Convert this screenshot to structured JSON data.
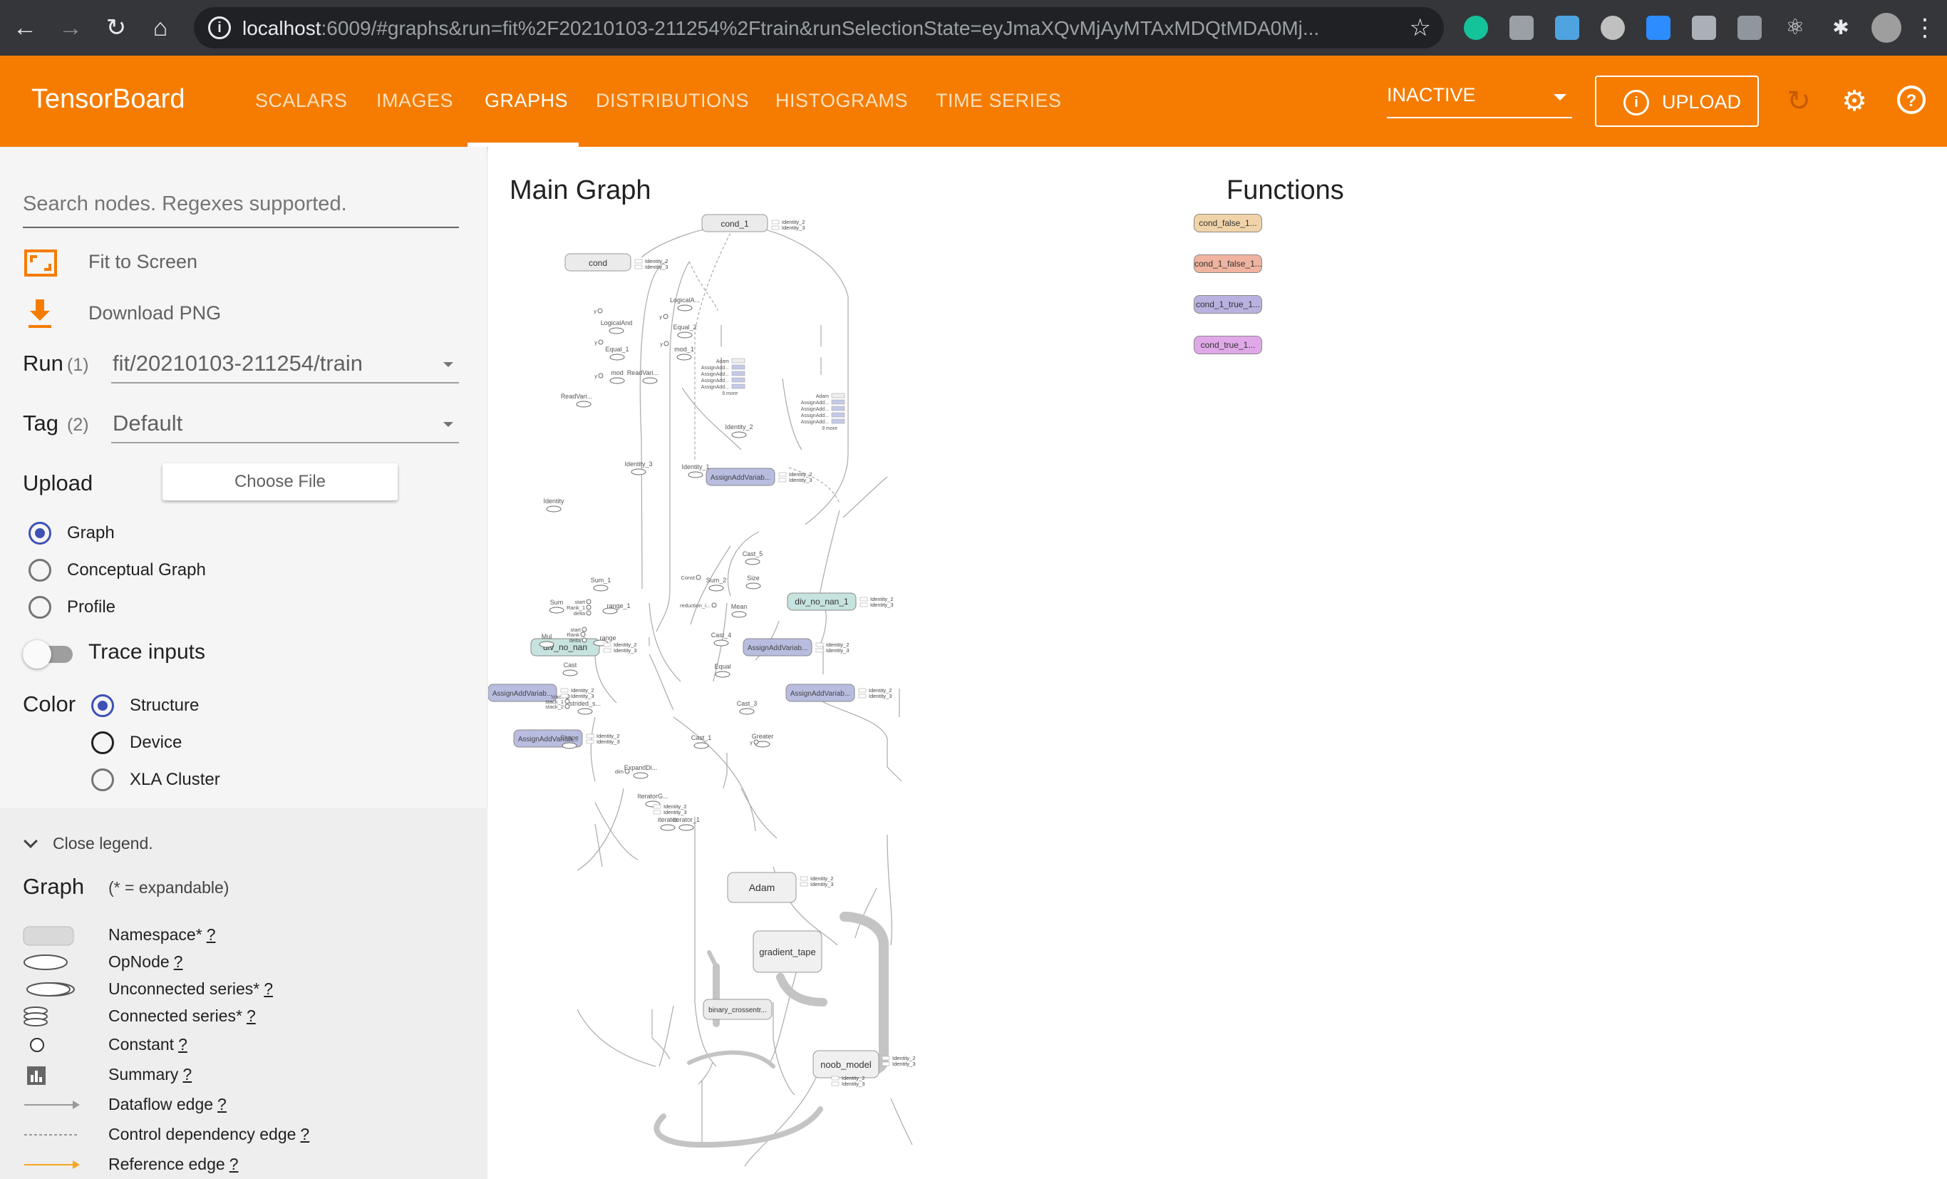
{
  "browser": {
    "url_host": "localhost",
    "url_rest": ":6009/#graphs&run=fit%2F20210103-211254%2Ftrain&runSelectionState=eyJmaXQvMjAyMTAxMDQtMDA0Mj..."
  },
  "header": {
    "app_title": "TensorBoard",
    "tabs": [
      {
        "label": "SCALARS",
        "active": false
      },
      {
        "label": "IMAGES",
        "active": false
      },
      {
        "label": "GRAPHS",
        "active": true
      },
      {
        "label": "DISTRIBUTIONS",
        "active": false
      },
      {
        "label": "HISTOGRAMS",
        "active": false
      },
      {
        "label": "TIME SERIES",
        "active": false
      }
    ],
    "status_select": "INACTIVE",
    "upload_label": "UPLOAD"
  },
  "sidebar": {
    "search_placeholder": "Search nodes. Regexes supported.",
    "fit_to_screen": "Fit to Screen",
    "download_png": "Download PNG",
    "run_label": "Run",
    "run_count": "(1)",
    "run_value": "fit/20210103-211254/train",
    "tag_label": "Tag",
    "tag_count": "(2)",
    "tag_value": "Default",
    "upload_label": "Upload",
    "choose_file": "Choose File",
    "graph_types": [
      {
        "label": "Graph",
        "selected": true
      },
      {
        "label": "Conceptual Graph",
        "selected": false
      },
      {
        "label": "Profile",
        "selected": false
      }
    ],
    "trace_inputs": "Trace inputs",
    "color_label": "Color",
    "color_options": [
      {
        "label": "Structure",
        "selected": true
      },
      {
        "label": "Device",
        "selected": false
      },
      {
        "label": "XLA Cluster",
        "selected": false
      }
    ]
  },
  "legend": {
    "close_label": "Close legend.",
    "title": "Graph",
    "subtitle": "(* = expandable)",
    "items": [
      {
        "label": "Namespace*",
        "q": "?"
      },
      {
        "label": "OpNode",
        "q": "?"
      },
      {
        "label": "Unconnected series*",
        "q": "?"
      },
      {
        "label": "Connected series*",
        "q": "?"
      },
      {
        "label": "Constant",
        "q": "?"
      },
      {
        "label": "Summary",
        "q": "?"
      },
      {
        "label": "Dataflow edge",
        "q": "?"
      },
      {
        "label": "Control dependency edge",
        "q": "?"
      },
      {
        "label": "Reference edge",
        "q": "?"
      }
    ]
  },
  "graph": {
    "main_title": "Main Graph",
    "functions_title": "Functions",
    "functions": [
      {
        "label": "cond_false_1...",
        "color": "#f0d3a8"
      },
      {
        "label": "cond_1_false_1...",
        "color": "#f0b3a0"
      },
      {
        "label": "cond_1_true_1...",
        "color": "#b9b2e0"
      },
      {
        "label": "cond_true_1...",
        "color": "#e0a8e8"
      }
    ],
    "namespaces": [
      {
        "label": "cond_1"
      },
      {
        "label": "cond"
      },
      {
        "label": "AssignAddVariab..."
      },
      {
        "label": "div_no_nan_1"
      },
      {
        "label": "div_no_nan"
      },
      {
        "label": "AssignAddVariab..."
      },
      {
        "label": "AssignAddVariab..."
      },
      {
        "label": "AssignAddVariab..."
      },
      {
        "label": "AssignAddVariab..."
      },
      {
        "label": "Adam"
      },
      {
        "label": "gradient_tape"
      },
      {
        "label": "binary_crossentr..."
      },
      {
        "label": "noob_model"
      }
    ],
    "op_labels": [
      "LogicalA...",
      "LogicalAnd",
      "Equal_2",
      "Equal_1",
      "mod_1",
      "mod",
      "ReadVari...",
      "ReadVari...",
      "Identity",
      "Identity_1",
      "Identity_3",
      "Identity_2",
      "Cast_5",
      "Size",
      "Sum_1",
      "Sum_2",
      "range_1",
      "Sum",
      "Mean",
      "range",
      "Mul",
      "Cast_4",
      "Cast",
      "Equal",
      "strided_s...",
      "Cast_3",
      "Shape",
      "Cast_1",
      "Greater",
      "ExpandDi...",
      "IteratorG...",
      "iterator",
      "iterator_1",
      "Const",
      "reduction_i...",
      "start",
      "Rank_1",
      "delta",
      "Rank",
      "stack",
      "stack_1",
      "stack_2",
      "dim",
      "y",
      "Adam",
      "AssignAdd...",
      "9 more"
    ],
    "side_labels": [
      "Identity_2",
      "Identity_3"
    ]
  }
}
